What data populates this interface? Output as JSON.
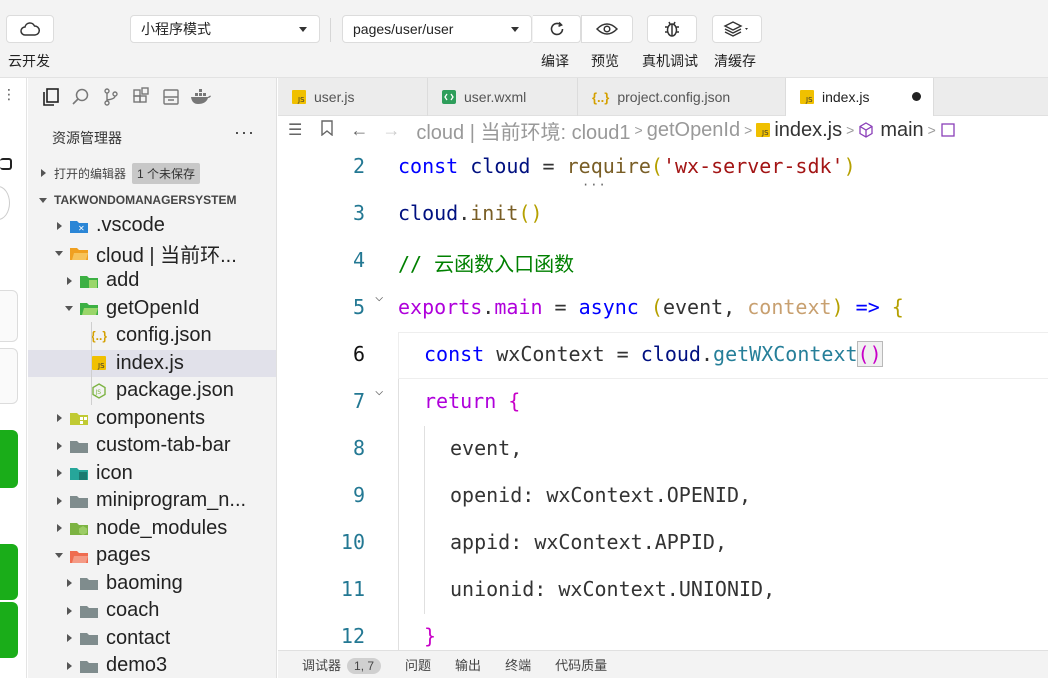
{
  "toolbar": {
    "cloud_label": "云开发",
    "mode_select": "小程序模式",
    "page_select": "pages/user/user",
    "compile_label": "编译",
    "preview_label": "预览",
    "debug_label": "真机调试",
    "clear_cache_label": "清缓存"
  },
  "sidebar": {
    "title": "资源管理器",
    "more": "···",
    "open_editors": "打开的编辑器",
    "unsaved_badge": "1 个未保存",
    "project_name": "TAKWONDOMANAGERSYSTEM",
    "tree": [
      {
        "name": ".vscode",
        "level": 0,
        "twisty": "right",
        "icon": "vscode-folder-icon"
      },
      {
        "name": "cloud | 当前环...",
        "level": 0,
        "twisty": "down",
        "icon": "cloud-folder-icon"
      },
      {
        "name": "add",
        "level": 1,
        "twisty": "right",
        "icon": "function-folder-icon"
      },
      {
        "name": "getOpenId",
        "level": 1,
        "twisty": "down",
        "icon": "function-folder-open-icon"
      },
      {
        "name": "config.json",
        "level": 2,
        "twisty": "none",
        "icon": "json-file-icon"
      },
      {
        "name": "index.js",
        "level": 2,
        "twisty": "none",
        "icon": "js-file-icon",
        "selected": true
      },
      {
        "name": "package.json",
        "level": 2,
        "twisty": "none",
        "icon": "nodejs-file-icon"
      },
      {
        "name": "components",
        "level": 0,
        "twisty": "right",
        "icon": "components-folder-icon"
      },
      {
        "name": "custom-tab-bar",
        "level": 0,
        "twisty": "right",
        "icon": "folder-icon"
      },
      {
        "name": "icon",
        "level": 0,
        "twisty": "right",
        "icon": "icon-folder-icon"
      },
      {
        "name": "miniprogram_n...",
        "level": 0,
        "twisty": "right",
        "icon": "folder-icon"
      },
      {
        "name": "node_modules",
        "level": 0,
        "twisty": "right",
        "icon": "node-modules-folder-icon"
      },
      {
        "name": "pages",
        "level": 0,
        "twisty": "down",
        "icon": "pages-folder-icon"
      },
      {
        "name": "baoming",
        "level": 1,
        "twisty": "right",
        "icon": "folder-icon"
      },
      {
        "name": "coach",
        "level": 1,
        "twisty": "right",
        "icon": "folder-icon"
      },
      {
        "name": "contact",
        "level": 1,
        "twisty": "right",
        "icon": "folder-icon"
      },
      {
        "name": "demo3",
        "level": 1,
        "twisty": "right",
        "icon": "folder-icon"
      }
    ]
  },
  "tabs": [
    {
      "label": "user.js",
      "icon": "js-file-icon"
    },
    {
      "label": "user.wxml",
      "icon": "wxml-file-icon"
    },
    {
      "label": "project.config.json",
      "icon": "json-file-icon"
    },
    {
      "label": "index.js",
      "icon": "js-file-icon",
      "active": true
    }
  ],
  "breadcrumb": {
    "part1": "cloud | 当前环境: cloud1",
    "part2": "getOpenId",
    "part3": "index.js",
    "part4": "main"
  },
  "editor": {
    "line_numbers": [
      "2",
      "3",
      "4",
      "5",
      "6",
      "7",
      "8",
      "9",
      "10",
      "11",
      "12"
    ]
  },
  "bottom": {
    "debugger": "调试器",
    "debugger_badge": "1, 7",
    "problems": "问题",
    "output": "输出",
    "terminal": "终端",
    "code_quality": "代码质量"
  },
  "colors": {
    "accent_green": "#1aad19",
    "keyword": "#0000ff",
    "comment": "#008000",
    "string": "#a31515"
  }
}
